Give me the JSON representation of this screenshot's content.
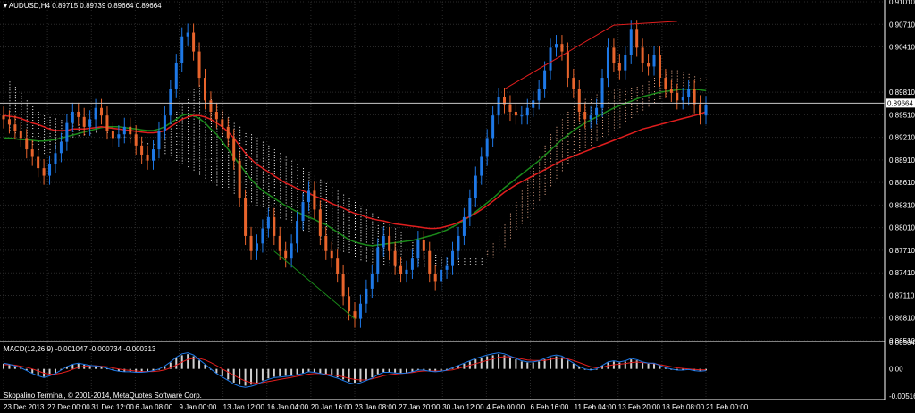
{
  "header": {
    "symbol": "AUDUSD,H4",
    "ohlc": "0.89715 0.89739 0.89664 0.89664"
  },
  "macd_header": "MACD(12,26,9) -0.001047 -0.000734 -0.000313",
  "copyright": "Skopalino Terminal, © 2001-2014, MetaQuotes Software Corp.",
  "colors": {
    "background": "#000000",
    "grid": "#2a2a2a",
    "bull": "#1e78e6",
    "bear": "#e8642c",
    "ma_fast": "#e01e1e",
    "ma_slow": "#1a8a1a",
    "cloud_a": "#ffffff",
    "cloud_b": "#f0b090",
    "price_line": "#c8c8c8"
  },
  "chart_data": {
    "type": "candlestick",
    "price_axis": {
      "ticks": [
        "0.91010",
        "0.90710",
        "0.90410",
        "0.89810",
        "0.89510",
        "0.89210",
        "0.88910",
        "0.88610",
        "0.88310",
        "0.88010",
        "0.87710",
        "0.87410",
        "0.87110",
        "0.86810",
        "0.86510"
      ],
      "ylim": [
        0.8651,
        0.9101
      ],
      "current_price": "0.89664",
      "grid": true
    },
    "time_axis": {
      "ticks": [
        "23 Dec 2013",
        "27 Dec 00:00",
        "31 Dec 12:00",
        "6 Jan 08:00",
        "9 Jan 00:00",
        "13 Jan 12:00",
        "16 Jan 04:00",
        "20 Jan 16:00",
        "23 Jan 08:00",
        "27 Jan 20:00",
        "30 Jan 12:00",
        "4 Feb 00:00",
        "6 Feb 16:00",
        "11 Feb 04:00",
        "13 Feb 20:00",
        "18 Feb 08:00",
        "21 Feb 00:00"
      ]
    },
    "price_path": [
      0.8945,
      0.8938,
      0.893,
      0.892,
      0.8905,
      0.8895,
      0.888,
      0.887,
      0.8885,
      0.89,
      0.8915,
      0.894,
      0.8955,
      0.8948,
      0.8935,
      0.8945,
      0.896,
      0.895,
      0.893,
      0.892,
      0.8925,
      0.8935,
      0.8925,
      0.891,
      0.8898,
      0.889,
      0.8905,
      0.893,
      0.895,
      0.8985,
      0.902,
      0.9055,
      0.906,
      0.9035,
      0.9,
      0.897,
      0.8955,
      0.8945,
      0.8935,
      0.892,
      0.889,
      0.884,
      0.879,
      0.877,
      0.878,
      0.88,
      0.8815,
      0.879,
      0.877,
      0.876,
      0.878,
      0.881,
      0.8835,
      0.885,
      0.8825,
      0.879,
      0.877,
      0.876,
      0.874,
      0.871,
      0.869,
      0.868,
      0.87,
      0.872,
      0.874,
      0.8775,
      0.879,
      0.877,
      0.875,
      0.874,
      0.8745,
      0.876,
      0.8785,
      0.877,
      0.874,
      0.873,
      0.8745,
      0.875,
      0.877,
      0.879,
      0.8815,
      0.884,
      0.887,
      0.8895,
      0.892,
      0.895,
      0.8975,
      0.8965,
      0.8955,
      0.895,
      0.895,
      0.896,
      0.897,
      0.8985,
      0.901,
      0.904,
      0.9045,
      0.9035,
      0.9,
      0.8985,
      0.8955,
      0.8945,
      0.895,
      0.896,
      0.9,
      0.904,
      0.902,
      0.901,
      0.903,
      0.9065,
      0.904,
      0.902,
      0.9015,
      0.903,
      0.9,
      0.8985,
      0.898,
      0.897,
      0.8975,
      0.8985,
      0.8965,
      0.895,
      0.8964
    ],
    "ma_red": [
      0.895,
      0.8949,
      0.8948,
      0.8946,
      0.8943,
      0.894,
      0.8938,
      0.8935,
      0.8932,
      0.893,
      0.893,
      0.893,
      0.8932,
      0.8932,
      0.8932,
      0.8933,
      0.8934,
      0.8935,
      0.8934,
      0.8933,
      0.8932,
      0.8931,
      0.893,
      0.8929,
      0.8928,
      0.8927,
      0.8927,
      0.8928,
      0.893,
      0.8935,
      0.894,
      0.8945,
      0.8948,
      0.895,
      0.895,
      0.8948,
      0.8945,
      0.894,
      0.8935,
      0.8928,
      0.892,
      0.891,
      0.89,
      0.8892,
      0.8885,
      0.888,
      0.8875,
      0.887,
      0.8865,
      0.886,
      0.8857,
      0.8853,
      0.885,
      0.8847,
      0.8843,
      0.884,
      0.8837,
      0.8833,
      0.883,
      0.8827,
      0.8823,
      0.882,
      0.8818,
      0.8815,
      0.8813,
      0.8811,
      0.881,
      0.8808,
      0.8806,
      0.8805,
      0.8804,
      0.8803,
      0.8802,
      0.8801,
      0.88,
      0.88,
      0.8801,
      0.8803,
      0.8805,
      0.8808,
      0.8812,
      0.8816,
      0.882,
      0.8825,
      0.883,
      0.8836,
      0.8842,
      0.8848,
      0.8853,
      0.8858,
      0.8862,
      0.8866,
      0.887,
      0.8874,
      0.8878,
      0.8882,
      0.8886,
      0.889,
      0.8893,
      0.8896,
      0.8899,
      0.8902,
      0.8905,
      0.8908,
      0.8911,
      0.8914,
      0.8917,
      0.892,
      0.8923,
      0.8926,
      0.8929,
      0.8932,
      0.8934,
      0.8936,
      0.8938,
      0.894,
      0.8942,
      0.8944,
      0.8946,
      0.8948,
      0.895,
      0.8952,
      0.8955
    ],
    "ma_green": [
      0.892,
      0.892,
      0.8919,
      0.8918,
      0.8918,
      0.8917,
      0.8916,
      0.8916,
      0.8917,
      0.8918,
      0.892,
      0.8922,
      0.8924,
      0.8926,
      0.8928,
      0.893,
      0.8932,
      0.8934,
      0.8935,
      0.8935,
      0.8935,
      0.8934,
      0.8933,
      0.8932,
      0.8931,
      0.893,
      0.893,
      0.8932,
      0.8935,
      0.894,
      0.8945,
      0.895,
      0.8952,
      0.895,
      0.8946,
      0.894,
      0.8932,
      0.8925,
      0.8915,
      0.8905,
      0.8895,
      0.8885,
      0.8875,
      0.8865,
      0.8857,
      0.885,
      0.8845,
      0.884,
      0.8835,
      0.883,
      0.8826,
      0.8822,
      0.8818,
      0.8815,
      0.8812,
      0.8808,
      0.8805,
      0.88,
      0.8795,
      0.879,
      0.8785,
      0.8782,
      0.878,
      0.8778,
      0.8777,
      0.8778,
      0.8779,
      0.878,
      0.8781,
      0.8782,
      0.8783,
      0.8784,
      0.8786,
      0.8788,
      0.879,
      0.8792,
      0.8795,
      0.8798,
      0.8802,
      0.8806,
      0.8811,
      0.8816,
      0.8822,
      0.8828,
      0.8834,
      0.884,
      0.8847,
      0.8854,
      0.886,
      0.8866,
      0.8872,
      0.8878,
      0.8884,
      0.889,
      0.8897,
      0.8904,
      0.8911,
      0.8918,
      0.8924,
      0.893,
      0.8935,
      0.894,
      0.8944,
      0.8948,
      0.8952,
      0.8956,
      0.896,
      0.8963,
      0.8966,
      0.8969,
      0.8972,
      0.8975,
      0.8977,
      0.8979,
      0.8981,
      0.8982,
      0.8983,
      0.8984,
      0.8985,
      0.8985,
      0.8985,
      0.8984,
      0.8983
    ],
    "cloud": [
      {
        "name": "cloud_white",
        "top": [
          0.9,
          0.8995,
          0.8988,
          0.898,
          0.897,
          0.8962,
          0.8955,
          0.895,
          0.8948,
          0.8946,
          0.8944,
          0.8942,
          0.894,
          0.8938,
          0.8936,
          0.8934,
          0.8932,
          0.893,
          0.8928,
          0.8926,
          0.8924,
          0.8922,
          0.892,
          0.8918,
          0.8915,
          0.8913,
          0.8912,
          0.8915,
          0.8925,
          0.894,
          0.8955,
          0.8965,
          0.8975,
          0.8985,
          0.899,
          0.8985,
          0.8975,
          0.8965,
          0.8955,
          0.8948,
          0.894,
          0.8935,
          0.893,
          0.8925,
          0.892,
          0.8915,
          0.891,
          0.8905,
          0.89,
          0.8895,
          0.889,
          0.8885,
          0.888,
          0.8875,
          0.887,
          0.8865,
          0.886,
          0.8855,
          0.885,
          0.8845,
          0.884,
          0.8835,
          0.883,
          0.8825,
          0.882,
          0.8815,
          0.881,
          0.8805,
          0.88,
          0.8795,
          0.879,
          0.8785,
          0.878,
          0.8775,
          0.877,
          0.8765,
          0.8762,
          0.876,
          0.876,
          0.876,
          0.876,
          0.876,
          0.876,
          0.876
        ],
        "bottom": [
          0.8935,
          0.893,
          0.8925,
          0.892,
          0.8915,
          0.891,
          0.8905,
          0.89,
          0.89,
          0.8905,
          0.891,
          0.8915,
          0.892,
          0.8922,
          0.8924,
          0.8925,
          0.8926,
          0.8927,
          0.8926,
          0.8924,
          0.8922,
          0.892,
          0.8918,
          0.8916,
          0.8913,
          0.891,
          0.8908,
          0.8905,
          0.89,
          0.8895,
          0.889,
          0.8885,
          0.888,
          0.8875,
          0.887,
          0.8866,
          0.8862,
          0.8858,
          0.8854,
          0.885,
          0.8846,
          0.8842,
          0.8838,
          0.8834,
          0.883,
          0.8826,
          0.8822,
          0.8818,
          0.8814,
          0.881,
          0.8806,
          0.8802,
          0.8798,
          0.8794,
          0.879,
          0.8786,
          0.8782,
          0.8778,
          0.8774,
          0.877,
          0.8766,
          0.8762,
          0.8758,
          0.8755,
          0.8752,
          0.875,
          0.875,
          0.875,
          0.875,
          0.875,
          0.875,
          0.875,
          0.875,
          0.875,
          0.875,
          0.875,
          0.875,
          0.875,
          0.875,
          0.875,
          0.875,
          0.875,
          0.875,
          0.875
        ]
      },
      {
        "name": "cloud_orange",
        "top": [
          0.877,
          0.878,
          0.879,
          0.8805,
          0.882,
          0.8835,
          0.885,
          0.8865,
          0.888,
          0.8895,
          0.891,
          0.8925,
          0.8935,
          0.8945,
          0.8955,
          0.8962,
          0.8968,
          0.8972,
          0.8975,
          0.8978,
          0.898,
          0.8982,
          0.8984,
          0.8985,
          0.8986,
          0.8987,
          0.8988,
          0.899,
          0.8995,
          0.9,
          0.9005,
          0.9008,
          0.901,
          0.901,
          0.9008,
          0.9005,
          0.9002,
          0.9,
          0.8998
        ],
        "bottom": [
          0.876,
          0.8762,
          0.8768,
          0.8775,
          0.8785,
          0.8795,
          0.8805,
          0.8815,
          0.8825,
          0.8835,
          0.8845,
          0.8855,
          0.8865,
          0.8875,
          0.8885,
          0.8895,
          0.89,
          0.8905,
          0.891,
          0.8915,
          0.892,
          0.8925,
          0.893,
          0.8935,
          0.894,
          0.8945,
          0.895,
          0.8955,
          0.896,
          0.8965,
          0.897,
          0.8975,
          0.898,
          0.8985,
          0.8988,
          0.899,
          0.8992,
          0.8994,
          0.8996
        ]
      }
    ],
    "macd_axis": {
      "ticks": [
        "0.005046",
        "0.00",
        "-0.005162"
      ],
      "ylim": [
        -0.005162,
        0.005046
      ]
    },
    "macd_hist": [
      0.001,
      0.0008,
      0.0005,
      0.0002,
      -0.0003,
      -0.0008,
      -0.0012,
      -0.0015,
      -0.0012,
      -0.0008,
      -0.0002,
      0.0004,
      0.0008,
      0.001,
      0.0008,
      0.0006,
      0.0005,
      0.0004,
      0.0001,
      -0.0002,
      -0.0004,
      -0.0005,
      -0.0005,
      -0.0006,
      -0.0006,
      -0.0005,
      -0.0003,
      0.0,
      0.0005,
      0.0012,
      0.002,
      0.0026,
      0.0028,
      0.0024,
      0.0016,
      0.0008,
      0.0,
      -0.0008,
      -0.0014,
      -0.002,
      -0.0026,
      -0.003,
      -0.0032,
      -0.003,
      -0.0027,
      -0.0022,
      -0.0018,
      -0.0015,
      -0.0014,
      -0.0013,
      -0.0012,
      -0.001,
      -0.0008,
      -0.0005,
      -0.0006,
      -0.0008,
      -0.001,
      -0.0013,
      -0.0016,
      -0.002,
      -0.0024,
      -0.0026,
      -0.0024,
      -0.002,
      -0.0016,
      -0.001,
      -0.0006,
      -0.0006,
      -0.0007,
      -0.0008,
      -0.0007,
      -0.0005,
      -0.0002,
      -0.0002,
      -0.0004,
      -0.0005,
      -0.0004,
      -0.0002,
      0.0002,
      0.0006,
      0.001,
      0.0014,
      0.0018,
      0.0021,
      0.0024,
      0.0026,
      0.0028,
      0.0026,
      0.0022,
      0.0018,
      0.0014,
      0.0012,
      0.0012,
      0.0014,
      0.0018,
      0.0022,
      0.0024,
      0.0022,
      0.0016,
      0.001,
      0.0004,
      0.0,
      -0.0002,
      0.0,
      0.0006,
      0.0012,
      0.0014,
      0.0012,
      0.0014,
      0.0018,
      0.0016,
      0.0012,
      0.001,
      0.001,
      0.0006,
      0.0002,
      0.0,
      -0.0002,
      -0.0002,
      -0.0001,
      -0.0003,
      -0.0004,
      -0.0003
    ],
    "macd_signal": [
      0.0008,
      0.0008,
      0.0007,
      0.0005,
      0.0003,
      0.0,
      -0.0004,
      -0.0008,
      -0.001,
      -0.001,
      -0.0008,
      -0.0005,
      -0.0001,
      0.0003,
      0.0005,
      0.0006,
      0.0006,
      0.0005,
      0.0004,
      0.0002,
      0.0,
      -0.0002,
      -0.0003,
      -0.0004,
      -0.0005,
      -0.0005,
      -0.0005,
      -0.0004,
      -0.0002,
      0.0002,
      0.0007,
      0.0013,
      0.0018,
      0.002,
      0.002,
      0.0017,
      0.0012,
      0.0006,
      0.0,
      -0.0006,
      -0.0012,
      -0.0018,
      -0.0023,
      -0.0026,
      -0.0027,
      -0.0026,
      -0.0024,
      -0.0022,
      -0.002,
      -0.0018,
      -0.0016,
      -0.0014,
      -0.0012,
      -0.001,
      -0.0009,
      -0.0009,
      -0.001,
      -0.0011,
      -0.0013,
      -0.0015,
      -0.0018,
      -0.002,
      -0.0021,
      -0.0021,
      -0.0019,
      -0.0016,
      -0.0013,
      -0.0011,
      -0.001,
      -0.0009,
      -0.0008,
      -0.0007,
      -0.0005,
      -0.0004,
      -0.0004,
      -0.0004,
      -0.0004,
      -0.0003,
      -0.0002,
      0.0001,
      0.0004,
      0.0007,
      0.001,
      0.0013,
      0.0016,
      0.0019,
      0.0022,
      0.0023,
      0.0023,
      0.0021,
      0.0019,
      0.0017,
      0.0016,
      0.0016,
      0.0016,
      0.0018,
      0.002,
      0.002,
      0.0019,
      0.0016,
      0.0012,
      0.0008,
      0.0004,
      0.0002,
      0.0003,
      0.0006,
      0.0008,
      0.0009,
      0.001,
      0.0012,
      0.0013,
      0.0012,
      0.0011,
      0.001,
      0.0008,
      0.0006,
      0.0004,
      0.0002,
      0.0001,
      0.0,
      -0.0001,
      -0.0002,
      -0.0002
    ]
  }
}
